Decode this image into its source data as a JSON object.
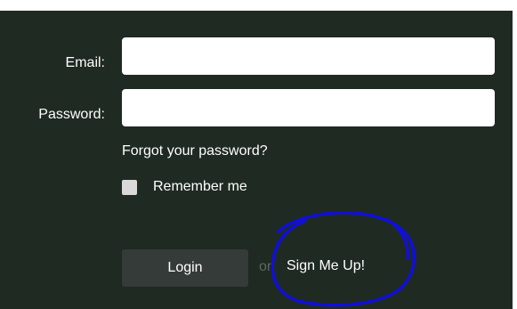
{
  "form": {
    "email_label": "Email:",
    "email_value": "",
    "password_label": "Password:",
    "password_value": "",
    "forgot_link": "Forgot your password?",
    "remember_label": "Remember me",
    "remember_checked": false,
    "login_label": "Login",
    "or_text": "or",
    "signup_label": "Sign Me Up!"
  },
  "colors": {
    "panel_background": "#1f2a22",
    "button_background": "#353b38",
    "annotation_circle": "#1010d8"
  }
}
